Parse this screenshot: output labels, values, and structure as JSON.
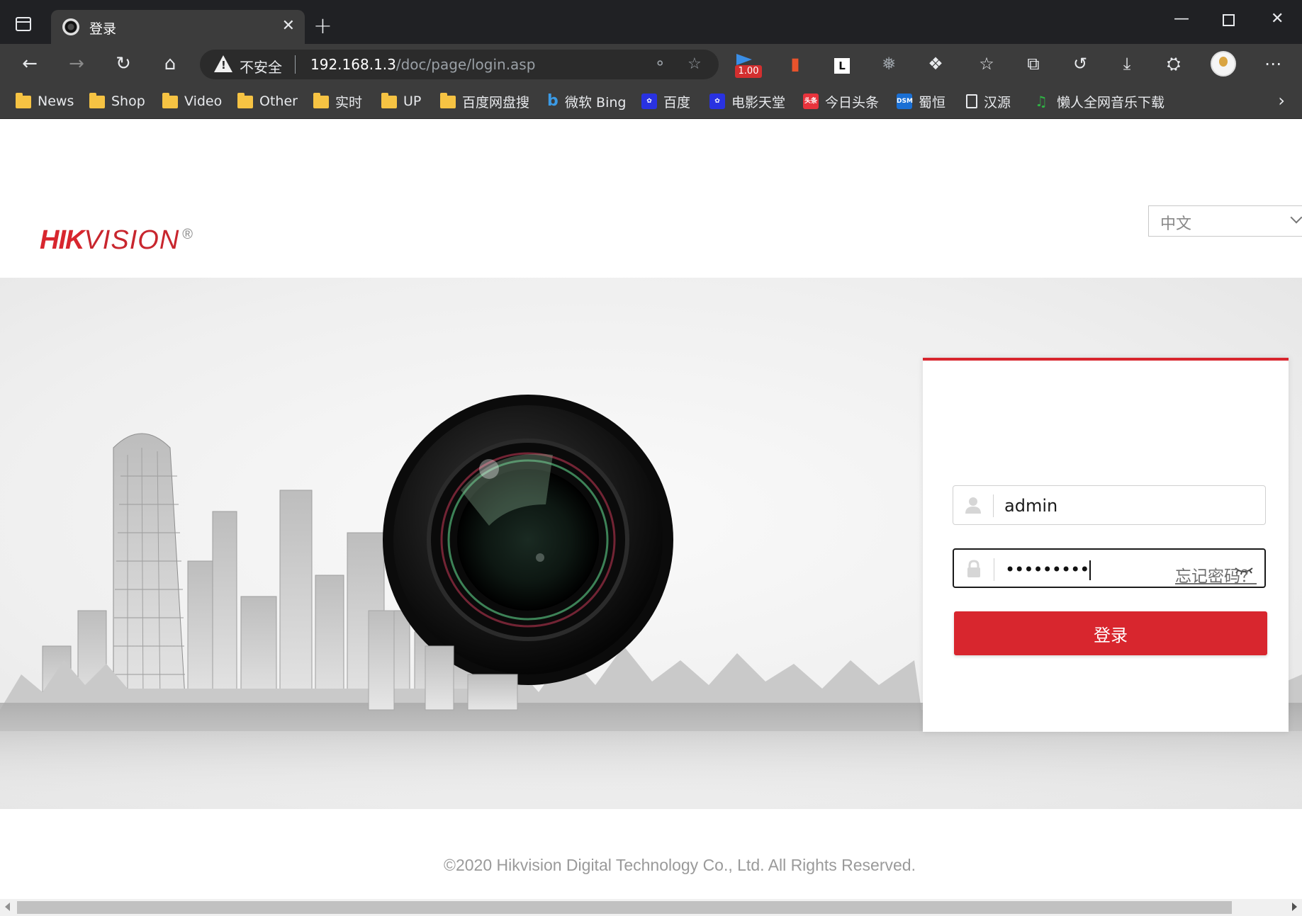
{
  "browser": {
    "tab_title": "登录",
    "insecure_label": "不安全",
    "url_host": "192.168.1.3",
    "url_path": "/doc/page/login.asp",
    "extension_badge": "1.00"
  },
  "bookmarks": [
    {
      "label": "News",
      "icon": "folder-icon"
    },
    {
      "label": "Shop",
      "icon": "folder-icon"
    },
    {
      "label": "Video",
      "icon": "folder-icon"
    },
    {
      "label": "Other",
      "icon": "folder-icon"
    },
    {
      "label": "实时",
      "icon": "folder-icon"
    },
    {
      "label": "UP",
      "icon": "folder-icon"
    },
    {
      "label": "百度网盘搜",
      "icon": "folder-icon"
    },
    {
      "label": "微软 Bing",
      "icon": "bing-icon"
    },
    {
      "label": "百度",
      "icon": "baidu-icon"
    },
    {
      "label": "电影天堂",
      "icon": "baidu-icon"
    },
    {
      "label": "今日头条",
      "icon": "toutiao-icon"
    },
    {
      "label": "蜀恒",
      "icon": "dsm-icon"
    },
    {
      "label": "汉源",
      "icon": "page-icon"
    },
    {
      "label": "懒人全网音乐下载",
      "icon": "music-icon"
    }
  ],
  "bookmark_badges": {
    "toutiao": "头条",
    "dsm": "DSM"
  },
  "page": {
    "logo_hik": "HIK",
    "logo_vision": "VISION",
    "logo_reg": "®",
    "language": "中文",
    "username": "admin",
    "password_mask": "•••••••••",
    "forgot_password": "忘记密码？",
    "login_button": "登录",
    "footer": "©2020 Hikvision Digital Technology Co., Ltd. All Rights Reserved."
  },
  "colors": {
    "brand_red": "#d8262e",
    "chrome_dark": "#3c3c3c",
    "titlebar": "#202124"
  }
}
